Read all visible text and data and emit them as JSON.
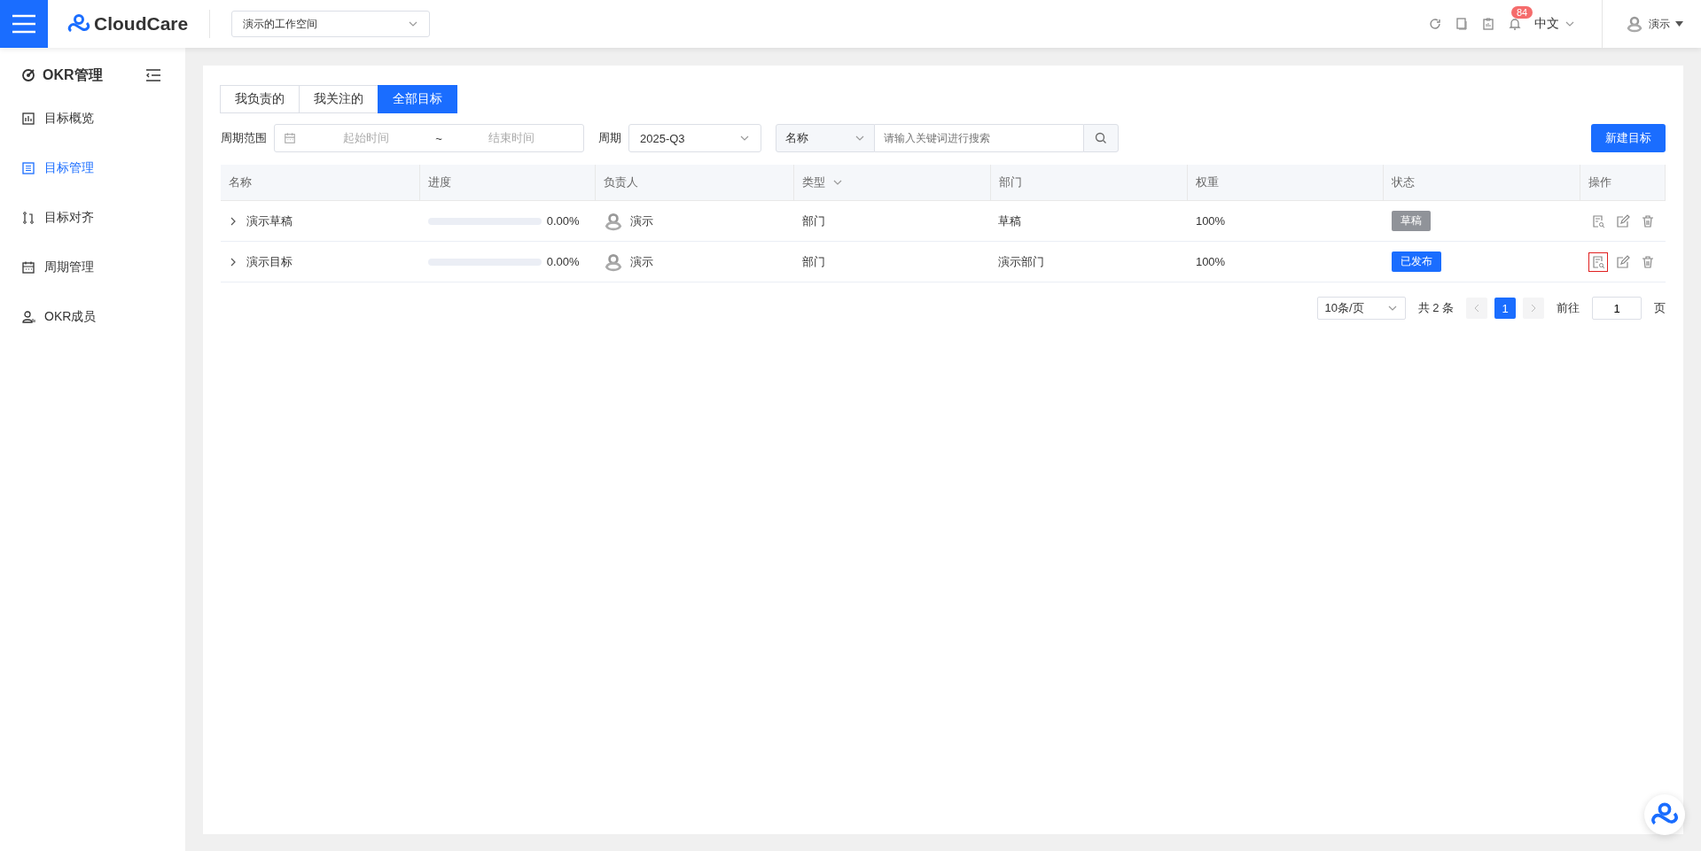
{
  "header": {
    "logo": "CloudCare",
    "workspace": "演示的工作空间",
    "notification_count": "84",
    "language": "中文",
    "user": "演示"
  },
  "sidebar": {
    "title": "OKR管理",
    "items": [
      {
        "label": "目标概览",
        "selected": false
      },
      {
        "label": "目标管理",
        "selected": true
      },
      {
        "label": "目标对齐",
        "selected": false
      },
      {
        "label": "周期管理",
        "selected": false
      },
      {
        "label": "OKR成员",
        "selected": false
      }
    ]
  },
  "tabs": [
    {
      "label": "我负责的",
      "selected": false
    },
    {
      "label": "我关注的",
      "selected": false
    },
    {
      "label": "全部目标",
      "selected": true
    }
  ],
  "filters": {
    "range_label": "周期范围",
    "start_placeholder": "起始时间",
    "separator": "~",
    "end_placeholder": "结束时间",
    "period_label": "周期",
    "period_value": "2025-Q3",
    "search_field": "名称",
    "search_placeholder": "请输入关键词进行搜索"
  },
  "new_button": "新建目标",
  "table": {
    "columns": [
      {
        "label": "名称",
        "sortable": false
      },
      {
        "label": "进度",
        "sortable": false
      },
      {
        "label": "负责人",
        "sortable": false
      },
      {
        "label": "类型",
        "sortable": true
      },
      {
        "label": "部门",
        "sortable": false
      },
      {
        "label": "权重",
        "sortable": false
      },
      {
        "label": "状态",
        "sortable": false
      },
      {
        "label": "操作",
        "sortable": false
      }
    ],
    "rows": [
      {
        "name": "演示草稿",
        "level": 0,
        "progress": "0.00%",
        "owner": "演示",
        "type": "部门",
        "department": "草稿",
        "weight": "100%",
        "status": "草稿",
        "color": "#909399",
        "view_highlighted": false
      },
      {
        "name": "演示目标",
        "level": 0,
        "progress": "0.00%",
        "owner": "演示",
        "type": "部门",
        "department": "演示部门",
        "weight": "100%",
        "status": "已发布",
        "color": "#1a6dff",
        "view_highlighted": true
      }
    ]
  },
  "pagination": {
    "page_size": "10条/页",
    "total": "共 2 条",
    "pages": [
      {
        "label": "1",
        "selected": true
      }
    ],
    "goto_label": "前往",
    "goto_value": "1",
    "page_suffix": "页"
  }
}
